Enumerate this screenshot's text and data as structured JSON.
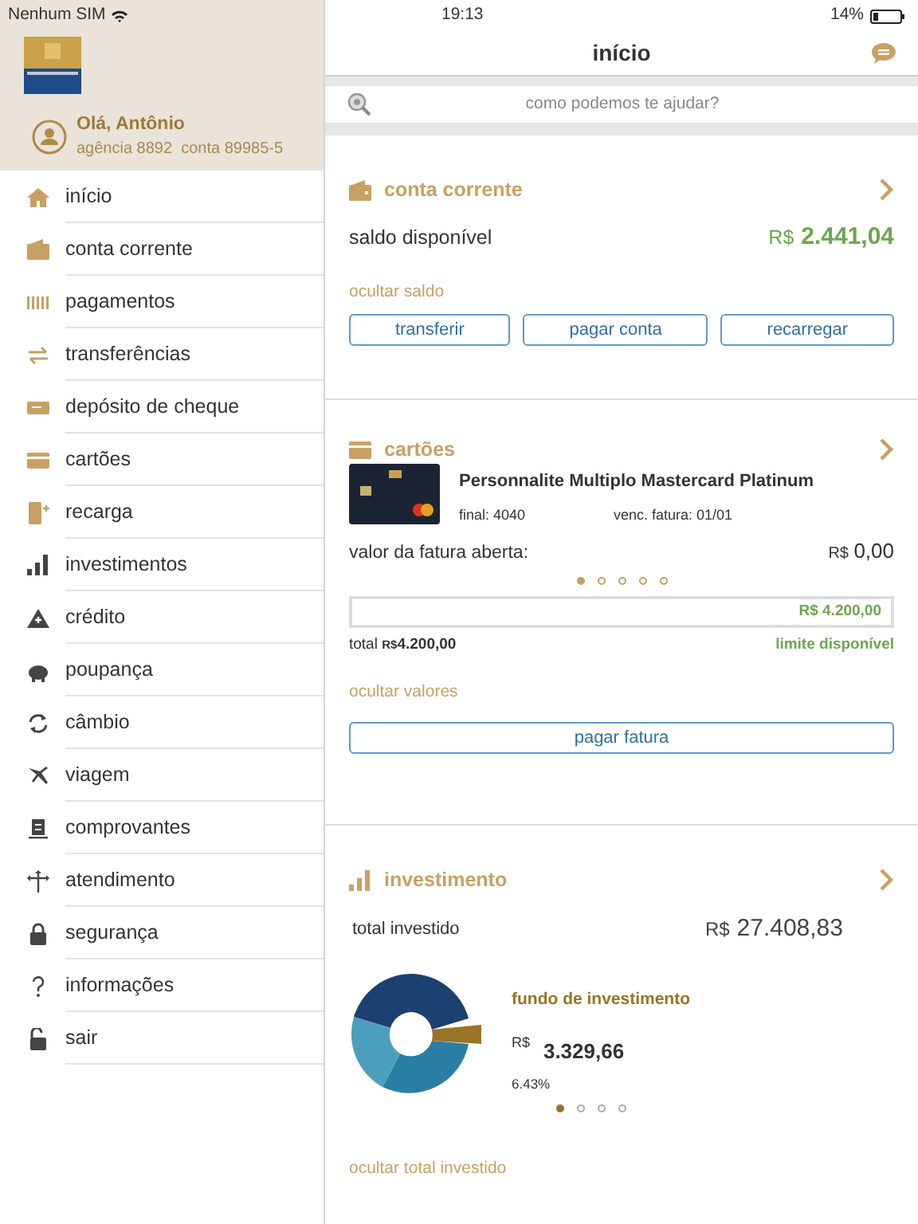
{
  "status_bar": {
    "carrier": "Nenhum SIM",
    "time": "19:13",
    "battery": "14%"
  },
  "sidebar": {
    "greeting": "Olá, Antônio",
    "account": "agência 8892  conta 89985-5",
    "items": [
      {
        "label": "início"
      },
      {
        "label": "conta corrente"
      },
      {
        "label": "pagamentos"
      },
      {
        "label": "transferências"
      },
      {
        "label": "depósito de cheque"
      },
      {
        "label": "cartões"
      },
      {
        "label": "recarga"
      },
      {
        "label": "investimentos"
      },
      {
        "label": "crédito"
      },
      {
        "label": "poupança"
      },
      {
        "label": "câmbio"
      },
      {
        "label": "viagem"
      },
      {
        "label": "comprovantes"
      },
      {
        "label": "atendimento"
      },
      {
        "label": "segurança"
      },
      {
        "label": "informações"
      },
      {
        "label": "sair"
      }
    ]
  },
  "header": {
    "title": "início"
  },
  "search": {
    "placeholder": "como podemos te ajudar?"
  },
  "checking": {
    "title": "conta corrente",
    "balance_label": "saldo disponível",
    "balance_currency": "R$",
    "balance_amount": "2.441,04",
    "hide_link": "ocultar saldo",
    "buttons": [
      "transferir",
      "pagar conta",
      "recarregar"
    ]
  },
  "cards": {
    "title": "cartões",
    "card_name": "Personnalite Multiplo Mastercard Platinum",
    "final": "final: 4040",
    "due": "venc. fatura: 01/01",
    "open_label": "valor da fatura aberta:",
    "open_currency": "R$",
    "open_amount": "0,00",
    "pager": [
      {
        "selected": true
      },
      {
        "selected": false
      },
      {
        "selected": false
      },
      {
        "selected": false
      },
      {
        "selected": false
      }
    ],
    "limit_bar": {
      "level": 0,
      "reading": "R$ 4.200,00"
    },
    "total_label": "total",
    "total_currency": "R$",
    "total_amount": "4.200,00",
    "limit_label": "limite disponível",
    "hide_link": "ocultar valores",
    "pay_button": "pagar fatura"
  },
  "investment": {
    "title": "investimento",
    "total_label": "total investido",
    "total_currency": "R$",
    "total_amount": "27.408,83",
    "fund_name": "fundo de investimento",
    "fund_currency": "R$",
    "fund_amount": "3.329,66",
    "fund_percent": "6.43%",
    "pager": [
      {
        "selected": true
      },
      {
        "selected": false
      },
      {
        "selected": false
      },
      {
        "selected": false
      }
    ],
    "hide_link": "ocultar total investido"
  }
}
